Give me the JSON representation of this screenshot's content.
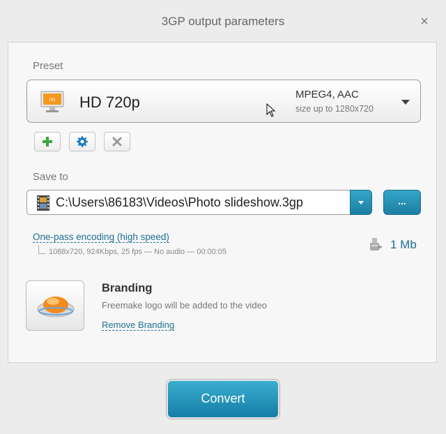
{
  "window": {
    "title": "3GP output parameters",
    "close_glyph": "×"
  },
  "preset": {
    "label": "Preset",
    "name": "HD 720p",
    "codec": "MPEG4, AAC",
    "size": "size up to 1280x720",
    "icon": "hd-monitor-icon"
  },
  "preset_actions": {
    "add_icon": "plus-icon",
    "edit_icon": "gear-icon",
    "delete_icon": "x-icon"
  },
  "save_to": {
    "label": "Save to",
    "path": "C:\\Users\\86183\\Videos\\Photo slideshow.3gp",
    "browse_label": "..."
  },
  "encoding": {
    "mode_link": "One-pass encoding (high speed)",
    "details": "1088x720, 924Kbps, 25 fps — No audio — 00:00:05",
    "file_size": "1 Mb"
  },
  "branding": {
    "title": "Branding",
    "description": "Freemake logo will be added to the video",
    "remove_link": "Remove Branding"
  },
  "convert": {
    "label": "Convert"
  },
  "colors": {
    "accent": "#1f8ab0",
    "link": "#1f6f96",
    "add_green": "#3aa63a",
    "gear_blue": "#1a7fc0"
  }
}
